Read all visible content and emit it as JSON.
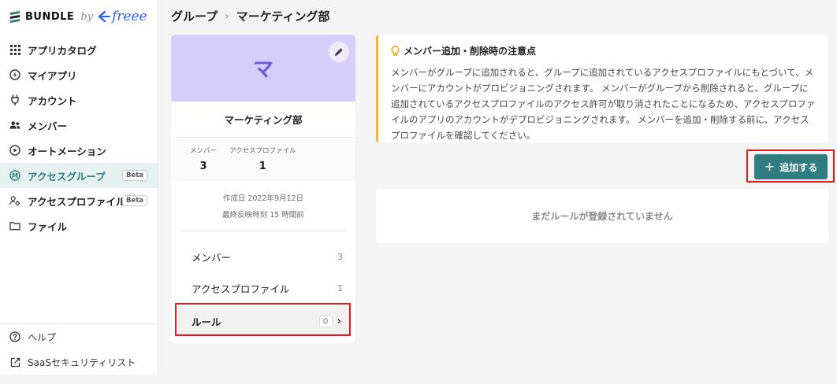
{
  "brand": {
    "name": "BUNDLE",
    "by": "by",
    "partner": "freee",
    "colors": {
      "accent": "#2f7d80",
      "freee": "#2864f0",
      "highlight": "#e51b1b"
    }
  },
  "sidebar": {
    "items": [
      {
        "label": "アプリカタログ",
        "icon": "grid-icon"
      },
      {
        "label": "マイアプリ",
        "icon": "bolt-circle-icon"
      },
      {
        "label": "アカウント",
        "icon": "plug-icon"
      },
      {
        "label": "メンバー",
        "icon": "users-icon"
      },
      {
        "label": "オートメーション",
        "icon": "play-circle-icon"
      },
      {
        "label": "アクセスグループ",
        "icon": "group-icon",
        "badge": "Beta",
        "active": true
      },
      {
        "label": "アクセスプロファイル",
        "icon": "user-settings-icon",
        "badge": "Beta"
      },
      {
        "label": "ファイル",
        "icon": "folder-icon"
      }
    ],
    "bottom": [
      {
        "label": "ヘルプ",
        "icon": "help-icon"
      },
      {
        "label": "SaaSセキュリティリスト",
        "icon": "external-link-icon"
      }
    ]
  },
  "breadcrumb": {
    "parent": "グループ",
    "separator": "›",
    "current": "マーケティング部"
  },
  "group": {
    "initial": "マ",
    "name": "マーケティング部",
    "stats": [
      {
        "label": "メンバー",
        "value": "3"
      },
      {
        "label": "アクセスプロファイル",
        "value": "1"
      }
    ],
    "created": "作成日 2022年9月12日",
    "last_reflected": "最終反映時刻 15 時間前",
    "tabs": [
      {
        "label": "メンバー",
        "count": "3"
      },
      {
        "label": "アクセスプロファイル",
        "count": "1"
      },
      {
        "label": "ルール",
        "count": "0",
        "active": true
      }
    ]
  },
  "notice": {
    "title": "メンバー追加・削除時の注意点",
    "body": "メンバーがグループに追加されると、グループに追加されているアクセスプロファイルにもとづいて、メンバーにアカウントがプロビジョニングされます。 メンバーがグループから削除されると、グループに追加されているアクセスプロファイルのアクセス許可が取り消されたことになるため、アクセスプロファイルのアプリのアカウントがデプロビジョニングされます。 メンバーを追加・削除する前に、アクセスプロファイルを確認してください。"
  },
  "actions": {
    "add_label": "追加する"
  },
  "rules": {
    "empty_text": "まだルールが登録されていません"
  }
}
